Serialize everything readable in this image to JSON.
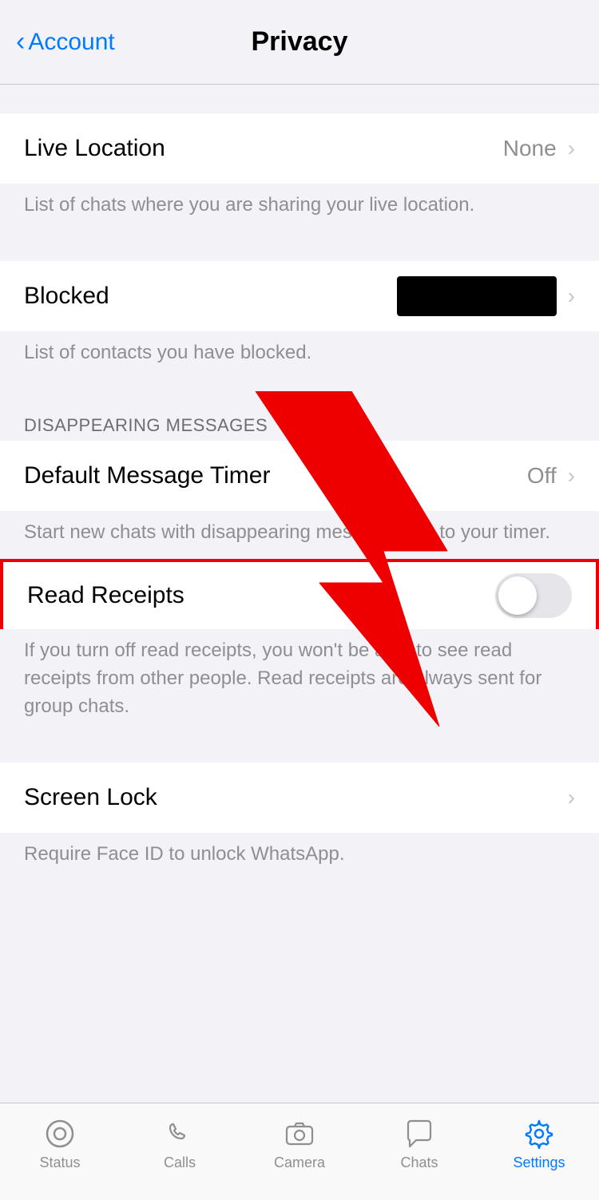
{
  "header": {
    "back_label": "Account",
    "title": "Privacy"
  },
  "sections": {
    "live_location": {
      "label": "Live Location",
      "value": "None",
      "description": "List of chats where you are sharing your live location."
    },
    "blocked": {
      "label": "Blocked",
      "value_redacted": true,
      "description": "List of contacts you have blocked."
    },
    "disappearing_messages": {
      "section_header": "DISAPPEARING MESSAGES",
      "default_timer": {
        "label": "Default Message Timer",
        "value": "Off",
        "description": "Start new chats with disappearing messages set to your timer."
      }
    },
    "read_receipts": {
      "label": "Read Receipts",
      "toggle_on": false,
      "description": "If you turn off read receipts, you won't be able to see read receipts from other people. Read receipts are always sent for group chats."
    },
    "screen_lock": {
      "label": "Screen Lock",
      "description": "Require Face ID to unlock WhatsApp."
    }
  },
  "tab_bar": {
    "tabs": [
      {
        "label": "Status",
        "icon": "status",
        "active": false
      },
      {
        "label": "Calls",
        "icon": "calls",
        "active": false
      },
      {
        "label": "Camera",
        "icon": "camera",
        "active": false
      },
      {
        "label": "Chats",
        "icon": "chats",
        "active": false
      },
      {
        "label": "Settings",
        "icon": "settings",
        "active": true
      }
    ]
  }
}
